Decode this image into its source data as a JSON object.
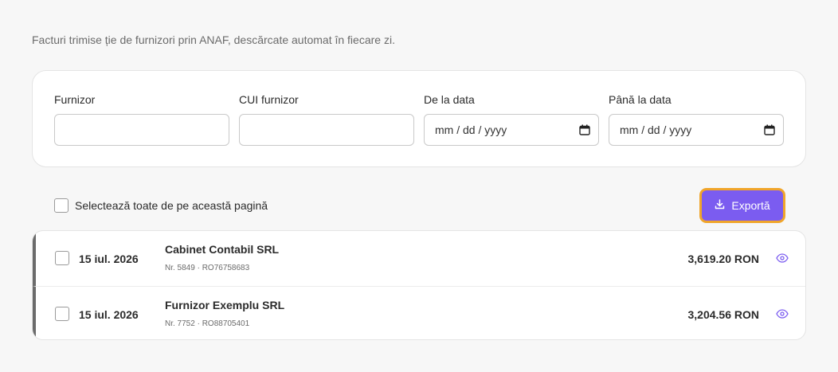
{
  "subtitle": "Facturi trimise ție de furnizori prin ANAF, descărcate automat în fiecare zi.",
  "filters": {
    "supplier_label": "Furnizor",
    "supplier_value": "",
    "cui_label": "CUI furnizor",
    "cui_value": "",
    "from_label": "De la data",
    "from_value": "mm / dd / yyyy",
    "to_label": "Până la data",
    "to_value": "mm / dd / yyyy"
  },
  "toolbar": {
    "select_all_label": "Selectează toate de pe această pagină",
    "export_label": "Exportă"
  },
  "invoices": [
    {
      "date": "15 iul. 2026",
      "supplier": "Cabinet Contabil SRL",
      "meta": "Nr. 5849 · RO76758683",
      "amount": "3,619.20 RON"
    },
    {
      "date": "15 iul. 2026",
      "supplier": "Furnizor Exemplu SRL",
      "meta": "Nr. 7752 · RO88705401",
      "amount": "3,204.56 RON"
    }
  ],
  "icons": {
    "calendar": "calendar-icon",
    "download": "download-icon",
    "view": "eye-icon"
  },
  "colors": {
    "accent": "#7b5cf0",
    "focus_ring": "#f0a52a",
    "row_marker": "#6b6b6b"
  }
}
